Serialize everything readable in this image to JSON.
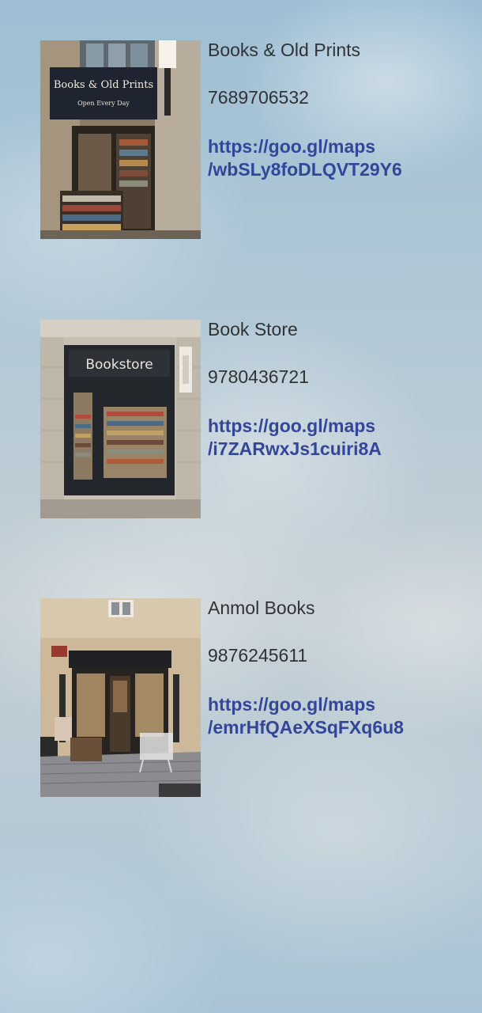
{
  "shops": [
    {
      "name": "Books & Old Prints",
      "phone": "7689706532",
      "link_line1": "https://goo.gl/maps",
      "link_line2": "/wbSLy8foDLQVT29Y6",
      "photo": {
        "sign_line1": "Books & Old Prints",
        "sign_line2": "Open Every Day"
      }
    },
    {
      "name": "Book Store",
      "phone": "9780436721",
      "link_line1": "https://goo.gl/maps",
      "link_line2": "/i7ZARwxJs1cuiri8A",
      "photo": {
        "sign_line1": "Bookstore"
      }
    },
    {
      "name": "Anmol Books",
      "phone": "9876245611",
      "link_line1": "https://goo.gl/maps",
      "link_line2": "/emrHfQAeXSqFXq6u8",
      "photo": {}
    }
  ],
  "colors": {
    "text": "#2f3336",
    "link": "#33469a",
    "background": "#b7cad6"
  }
}
